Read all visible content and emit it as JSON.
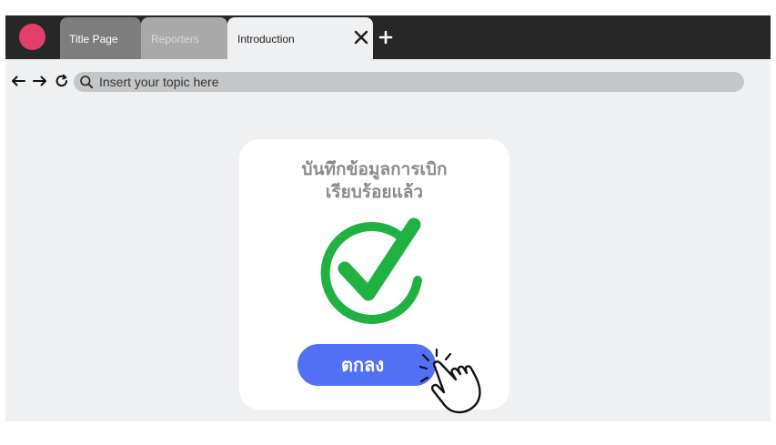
{
  "window": {
    "record_dot_color": "#e33f6c",
    "tabs": [
      {
        "label": "Title Page",
        "state": "inactive"
      },
      {
        "label": "Reporters",
        "state": "inactive"
      },
      {
        "label": "Introduction",
        "state": "active"
      }
    ],
    "tab_close_icon": "close-icon",
    "new_tab_icon": "plus-icon"
  },
  "toolbar": {
    "back_icon": "arrow-left-icon",
    "forward_icon": "arrow-right-icon",
    "reload_icon": "reload-icon",
    "search_icon": "search-icon",
    "address_text": "Insert your topic here"
  },
  "dialog": {
    "title_line1": "บันทึกข้อมูลการเบิก",
    "title_line2": "เรียบร้อยแล้ว",
    "success_icon": "check-circle-icon",
    "success_color": "#1fb141",
    "ok_label": "ตกลง",
    "ok_color": "#5270f5",
    "cursor_icon": "hand-pointer-icon"
  }
}
